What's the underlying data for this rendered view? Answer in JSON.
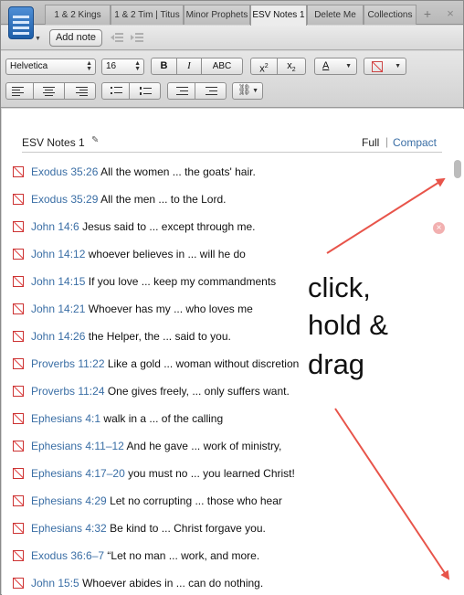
{
  "tabs": [
    "1 & 2 Kings",
    "1 & 2 Tim | Titus",
    "Minor Prophets",
    "ESV Notes 1",
    "Delete Me",
    "Collections"
  ],
  "active_tab": "ESV Notes 1",
  "tab_add_glyph": "+",
  "tab_close_glyph": "×",
  "toolbar": {
    "add_note_label": "Add note"
  },
  "format": {
    "font_family": "Helvetica",
    "font_size": "16",
    "bold": "B",
    "italic": "I",
    "caps": "ABC",
    "superscript_base": "x",
    "superscript_mark": "2",
    "subscript_base": "x",
    "subscript_mark": "2",
    "text_color_glyph": "A"
  },
  "pane": {
    "title": "ESV Notes 1",
    "edit_glyph": "✎",
    "view_full": "Full",
    "view_separator": "|",
    "view_compact": "Compact",
    "delete_glyph": "×"
  },
  "notes": [
    {
      "ref": "Exodus 35:26",
      "text": "All the women ... the goats' hair."
    },
    {
      "ref": "Exodus 35:29",
      "text": "All the men ... to the Lord."
    },
    {
      "ref": "John 14:6",
      "text": "Jesus said to ... except through me."
    },
    {
      "ref": "John 14:12",
      "text": "whoever believes in ... will he do"
    },
    {
      "ref": "John 14:15",
      "text": "If you love ... keep my commandments"
    },
    {
      "ref": "John 14:21",
      "text": "Whoever has my ... who loves me"
    },
    {
      "ref": "John 14:26",
      "text": "the Helper, the ... said to you."
    },
    {
      "ref": "Proverbs 11:22",
      "text": "Like a gold ... woman without discretion"
    },
    {
      "ref": "Proverbs 11:24",
      "text": "One gives freely, ... only suffers want."
    },
    {
      "ref": "Ephesians 4:1",
      "text": "walk in a ... of the calling"
    },
    {
      "ref": "Ephesians 4:11–12",
      "text": "And he gave ... work of ministry,"
    },
    {
      "ref": "Ephesians 4:17–20",
      "text": "you must no ... you learned Christ!"
    },
    {
      "ref": "Ephesians 4:29",
      "text": "Let no corrupting ... those who hear"
    },
    {
      "ref": "Ephesians 4:32",
      "text": "Be kind to ... Christ forgave you."
    },
    {
      "ref": "Exodus 36:6–7",
      "text": "“Let no man ... work, and more."
    },
    {
      "ref": "John 15:5",
      "text": "Whoever abides in ... can do nothing."
    }
  ],
  "annotation": {
    "line1": "click,",
    "line2": "hold &",
    "line3": "drag"
  },
  "colors": {
    "link": "#3a6ea5",
    "arrow": "#e8544a",
    "note_icon": "#d33333"
  }
}
